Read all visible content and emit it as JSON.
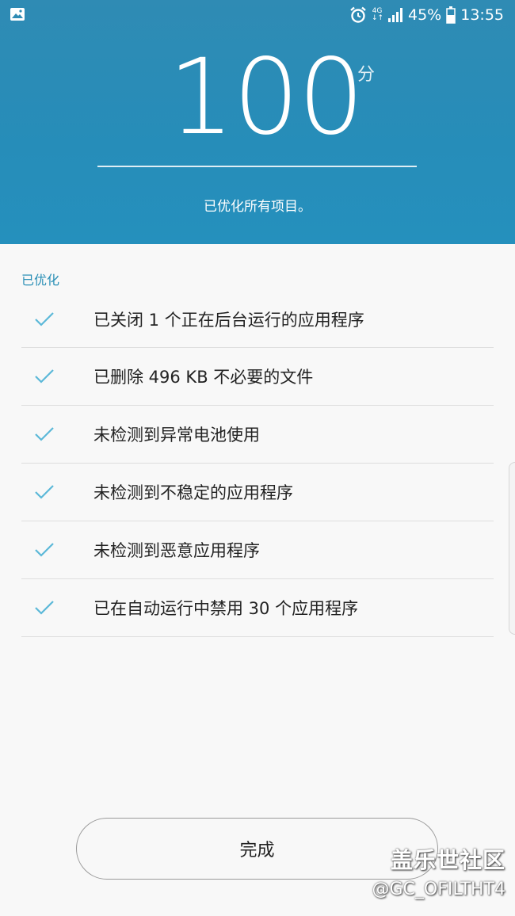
{
  "status_bar": {
    "battery_percent": "45%",
    "time": "13:55",
    "network_label": "4G",
    "icons": [
      "gallery-icon",
      "alarm-icon",
      "network-4g-icon",
      "signal-icon",
      "battery-icon"
    ]
  },
  "header": {
    "score": "100",
    "score_unit": "分",
    "message": "已优化所有项目。"
  },
  "section": {
    "title": "已优化"
  },
  "items": [
    {
      "label": "已关闭 1 个正在后台运行的应用程序"
    },
    {
      "label": "已删除 496 KB 不必要的文件"
    },
    {
      "label": "未检测到异常电池使用"
    },
    {
      "label": "未检测到不稳定的应用程序"
    },
    {
      "label": "未检测到恶意应用程序"
    },
    {
      "label": "已在自动运行中禁用 30 个应用程序"
    }
  ],
  "done_button": {
    "label": "完成"
  },
  "watermark": {
    "brand": "盖乐世社区",
    "user": "@GC_OFILTHT4"
  },
  "colors": {
    "header_bg": "#2590bd",
    "accent": "#2a8fb6",
    "check": "#5bb8d8"
  }
}
